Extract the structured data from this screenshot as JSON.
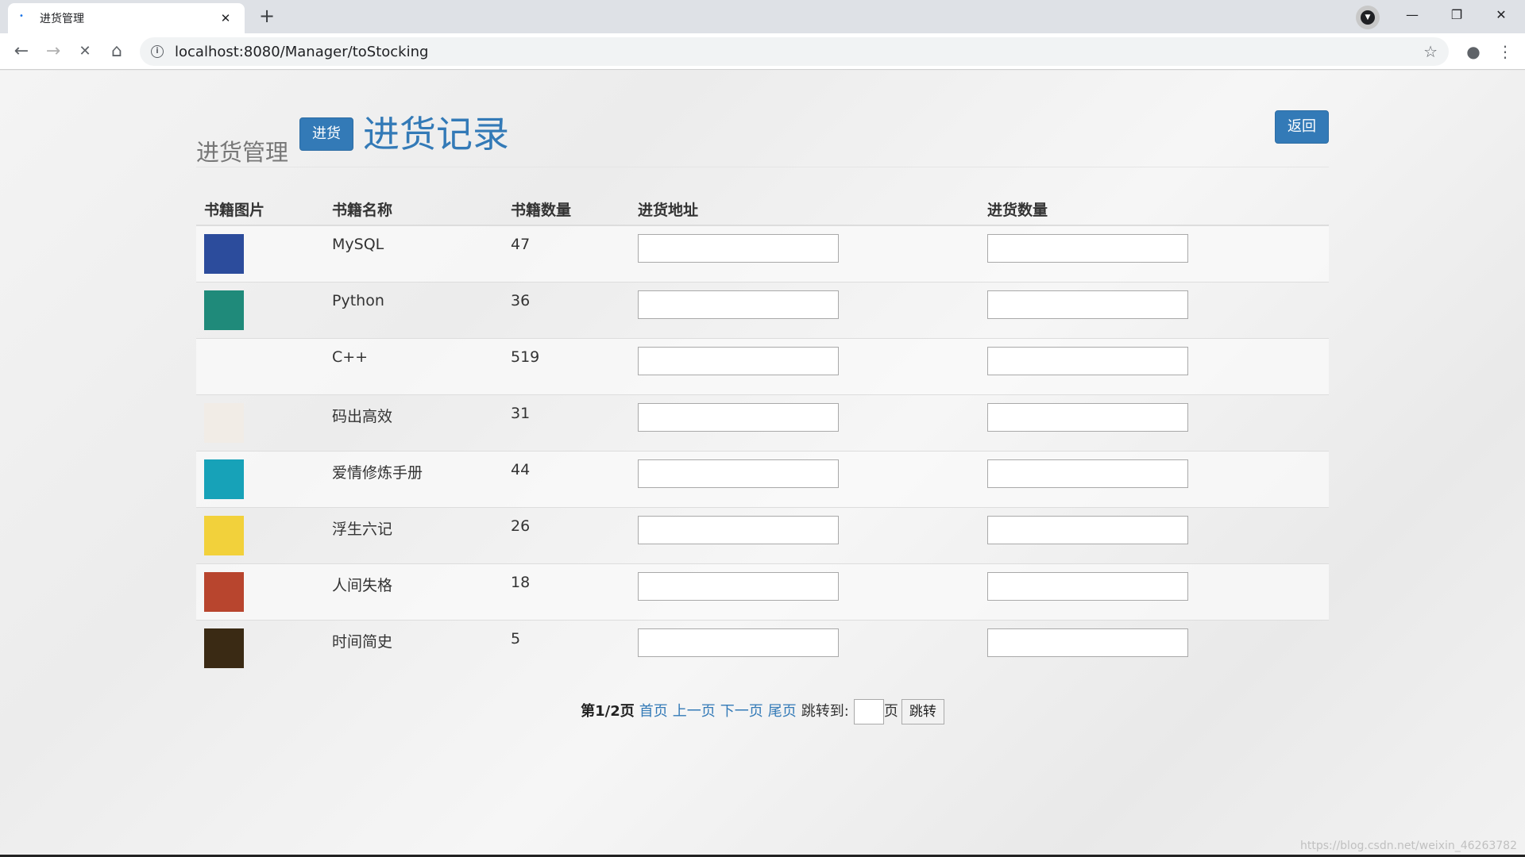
{
  "browser": {
    "tab_title": "进货管理",
    "tab_close": "✕",
    "new_tab": "+",
    "url": "localhost:8080/Manager/toStocking",
    "back": "←",
    "forward": "→",
    "reload": "✕",
    "home": "⌂",
    "info": "i",
    "star": "☆",
    "account": "●",
    "menu": "⋮",
    "minimize": "—",
    "restore": "❐",
    "close": "✕"
  },
  "header": {
    "label": "进货管理",
    "stock_button": "进货",
    "title": "进货记录",
    "back_button": "返回"
  },
  "table": {
    "columns": [
      "书籍图片",
      "书籍名称",
      "书籍数量",
      "进货地址",
      "进货数量"
    ],
    "rows": [
      {
        "name": "MySQL",
        "count": "47",
        "thumb_color": "#2c4c9c"
      },
      {
        "name": "Python",
        "count": "36",
        "thumb_color": "#1f8a7a"
      },
      {
        "name": "C++",
        "count": "519",
        "thumb_color": ""
      },
      {
        "name": "码出高效",
        "count": "31",
        "thumb_color": "#f1ece6"
      },
      {
        "name": "爱情修炼手册",
        "count": "44",
        "thumb_color": "#17a2b8"
      },
      {
        "name": "浮生六记",
        "count": "26",
        "thumb_color": "#f2d13b"
      },
      {
        "name": "人间失格",
        "count": "18",
        "thumb_color": "#b8452e"
      },
      {
        "name": "时间简史",
        "count": "5",
        "thumb_color": "#3a2a14"
      }
    ]
  },
  "pager": {
    "page_info": "第1/2页",
    "first": "首页",
    "prev": "上一页",
    "next": "下一页",
    "last": "尾页",
    "jump_label": "跳转到:",
    "page_unit": "页",
    "jump_button": "跳转"
  },
  "watermark": "https://blog.csdn.net/weixin_46263782"
}
